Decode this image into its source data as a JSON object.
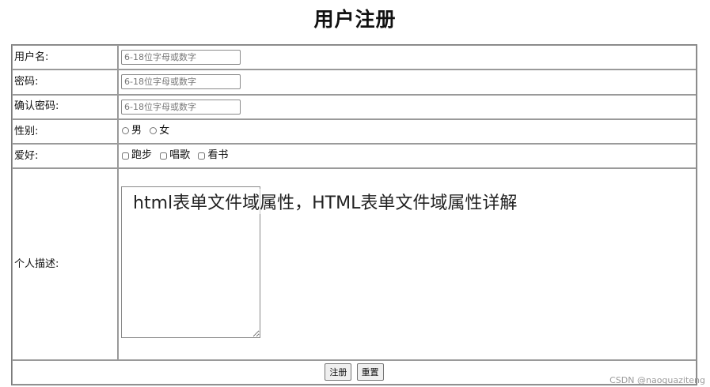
{
  "title": "用户注册",
  "fields": {
    "username": {
      "label": "用户名:",
      "placeholder": "6-18位字母或数字"
    },
    "password": {
      "label": "密码:",
      "placeholder": "6-18位字母或数字"
    },
    "confirm": {
      "label": "确认密码:",
      "placeholder": "6-18位字母或数字"
    },
    "gender": {
      "label": "性别:",
      "options": [
        "男",
        "女"
      ]
    },
    "hobby": {
      "label": "爱好:",
      "options": [
        "跑步",
        "唱歌",
        "看书"
      ]
    },
    "description": {
      "label": "个人描述:"
    }
  },
  "buttons": {
    "submit": "注册",
    "reset": "重置"
  },
  "overlay_caption": "html表单文件域属性，HTML表单文件域属性详解",
  "watermark": "CSDN @naoguaziteng"
}
